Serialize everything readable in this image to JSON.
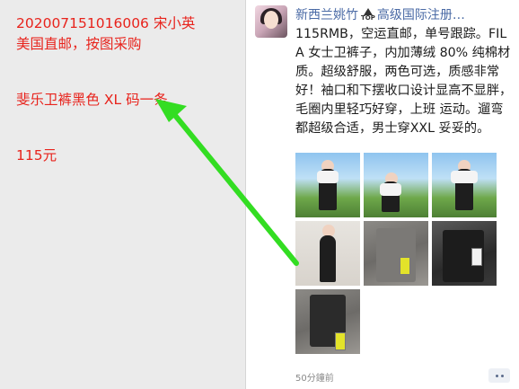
{
  "note": {
    "line1": "20200715101600​6   宋小英",
    "line2": "美国直邮，按图采购",
    "line3": "斐乐卫裤黑色 XL 码一条",
    "line4": "115元"
  },
  "post": {
    "author_name": "新西兰姚竹",
    "badge": "TOP",
    "author_title": "高级国际注册…",
    "text": "115RMB，空运直邮，单号跟踪。FILA 女士卫裤子，内加薄绒 80% 纯棉材质。超级舒服，两色可选，质感非常好！袖口和下摆收口设计显高不显胖，毛圈内里轻巧好穿，上班 运动。遛弯都超级合适，男士穿XXL 妥妥的。",
    "timestamp": "50分鐘前"
  },
  "colors": {
    "note_text": "#e8231c",
    "arrow": "#33dd22",
    "author_link": "#4a6aa5"
  }
}
